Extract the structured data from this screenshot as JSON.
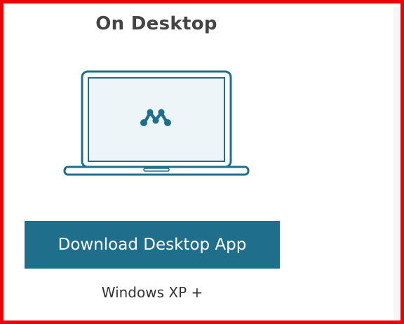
{
  "section": {
    "title": "On Desktop"
  },
  "illustration": {
    "icon": "laptop-icon",
    "logo": "mendeley-logo",
    "accent_color": "#1f6e8c",
    "screen_color": "#eef5f8"
  },
  "download": {
    "button_label": "Download Desktop App",
    "requirement": "Windows XP +"
  },
  "colors": {
    "frame_border": "#ee0000",
    "button_bg": "#1f6e8c",
    "title_text": "#444444"
  }
}
